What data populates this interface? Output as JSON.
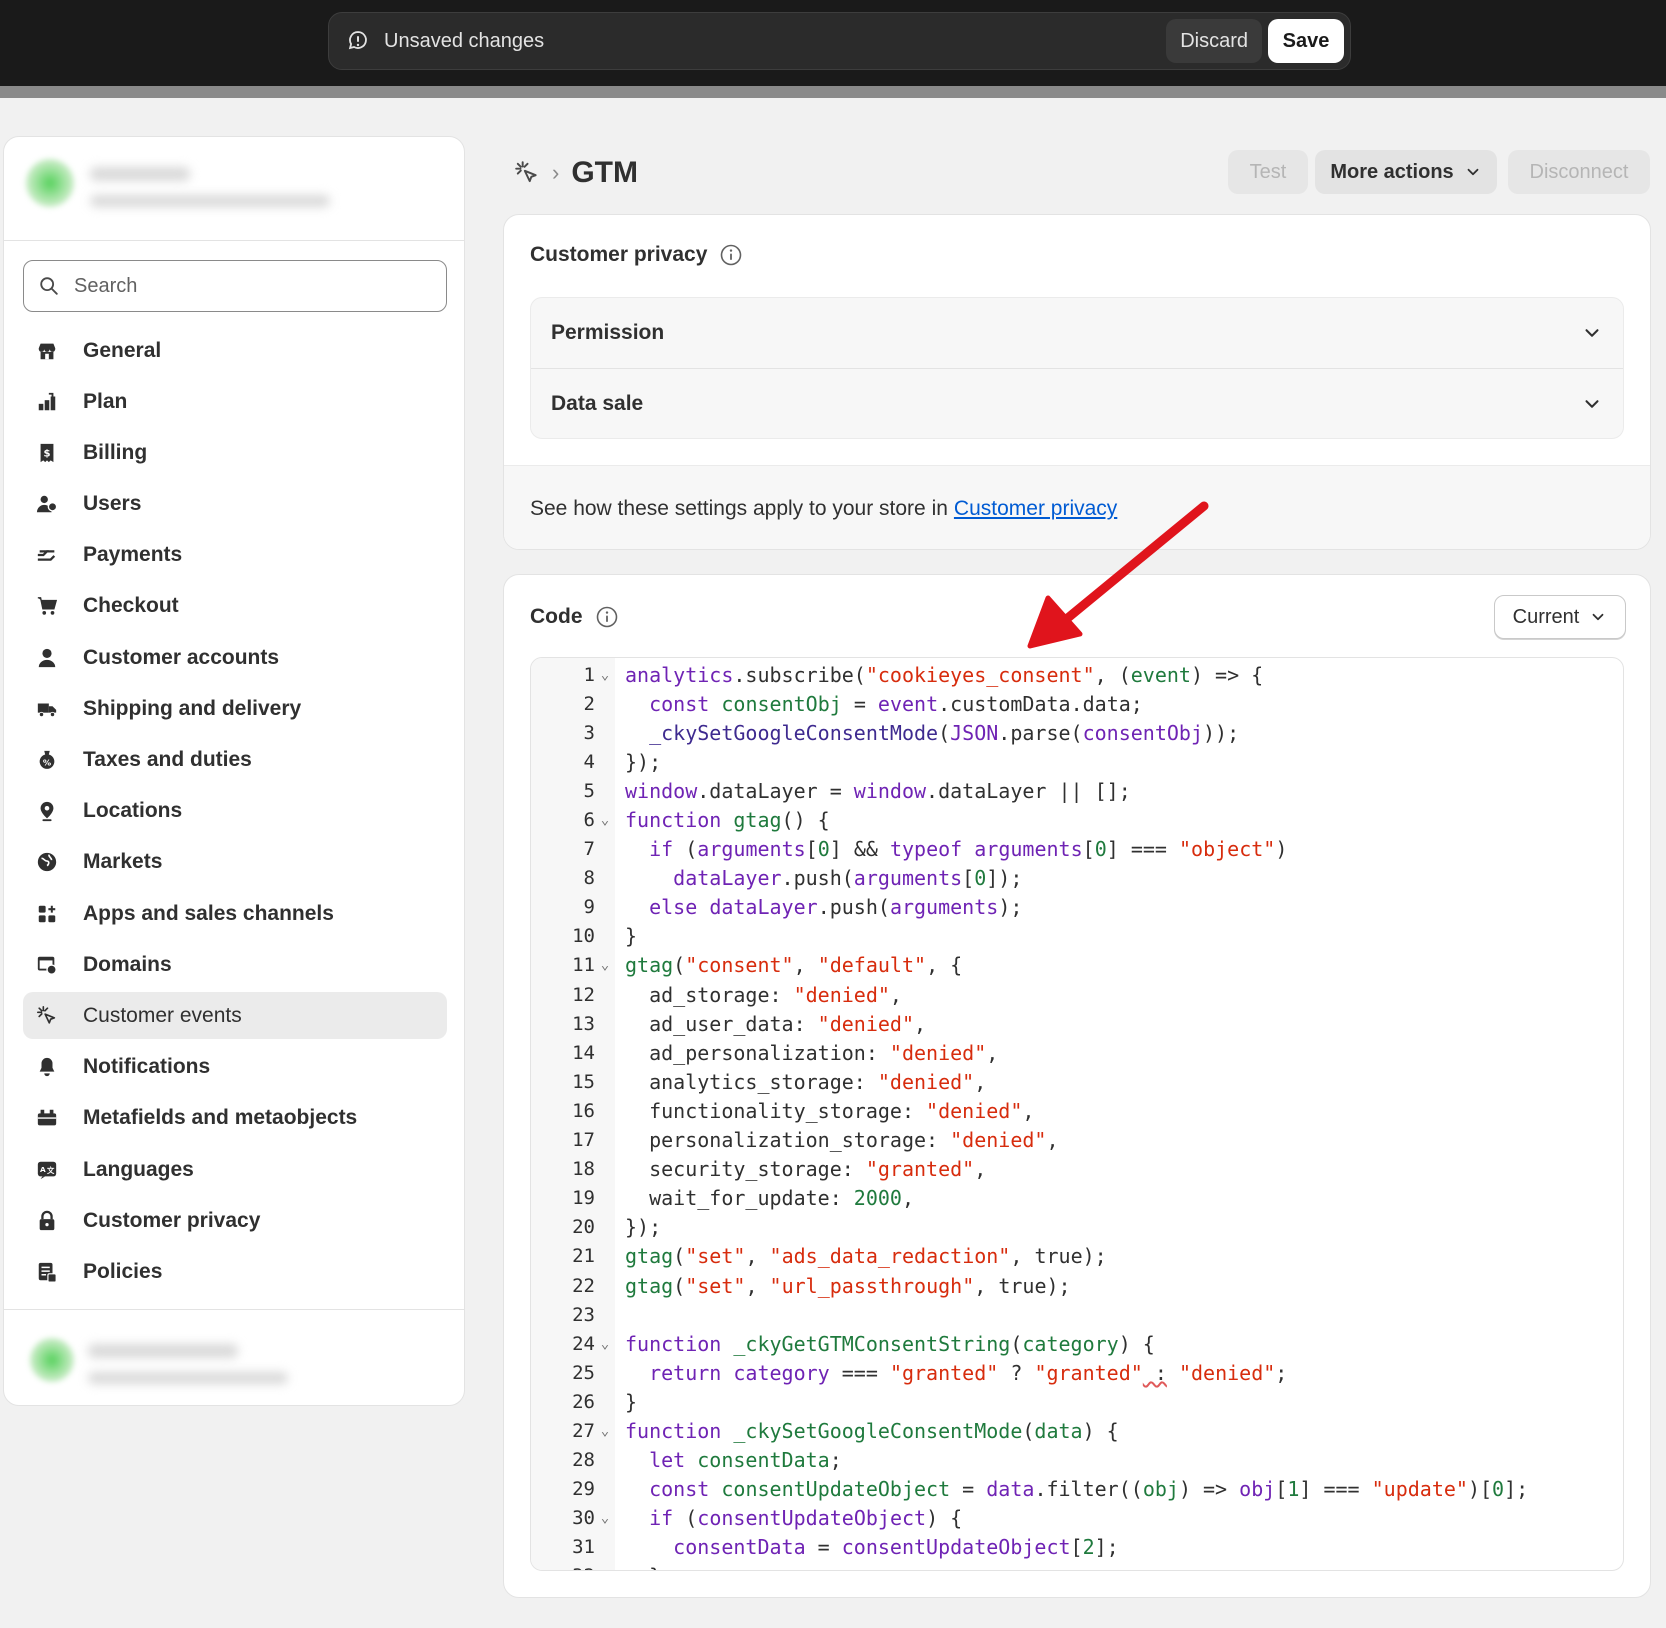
{
  "topbar": {
    "unsaved_text": "Unsaved changes",
    "discard_label": "Discard",
    "save_label": "Save"
  },
  "sidebar": {
    "search_placeholder": "Search",
    "items": [
      {
        "label": "General",
        "icon": "store-icon"
      },
      {
        "label": "Plan",
        "icon": "plan-icon"
      },
      {
        "label": "Billing",
        "icon": "billing-icon"
      },
      {
        "label": "Users",
        "icon": "users-icon"
      },
      {
        "label": "Payments",
        "icon": "payments-icon"
      },
      {
        "label": "Checkout",
        "icon": "cart-icon"
      },
      {
        "label": "Customer accounts",
        "icon": "person-icon"
      },
      {
        "label": "Shipping and delivery",
        "icon": "truck-icon"
      },
      {
        "label": "Taxes and duties",
        "icon": "tax-icon"
      },
      {
        "label": "Locations",
        "icon": "location-icon"
      },
      {
        "label": "Markets",
        "icon": "globe-icon"
      },
      {
        "label": "Apps and sales channels",
        "icon": "apps-icon"
      },
      {
        "label": "Domains",
        "icon": "domains-icon"
      },
      {
        "label": "Customer events",
        "icon": "cursor-click-icon",
        "active": true
      },
      {
        "label": "Notifications",
        "icon": "bell-icon"
      },
      {
        "label": "Metafields and metaobjects",
        "icon": "metafields-icon"
      },
      {
        "label": "Languages",
        "icon": "language-icon"
      },
      {
        "label": "Customer privacy",
        "icon": "lock-icon"
      },
      {
        "label": "Policies",
        "icon": "policies-icon"
      }
    ]
  },
  "header": {
    "title": "GTM",
    "test_label": "Test",
    "more_actions_label": "More actions",
    "disconnect_label": "Disconnect"
  },
  "privacy_card": {
    "title": "Customer privacy",
    "rows": [
      "Permission",
      "Data sale"
    ],
    "footer_text": "See how these settings apply to your store in",
    "footer_link": "Customer privacy"
  },
  "code_card": {
    "title": "Code",
    "version_label": "Current"
  },
  "colors": {
    "topbar": "#1a1a1a",
    "keyword": "#6f23b4",
    "string": "#d72c0d",
    "identifier": "#1f7a3d",
    "link": "#005bd3",
    "annotation_arrow": "#e0141c"
  }
}
